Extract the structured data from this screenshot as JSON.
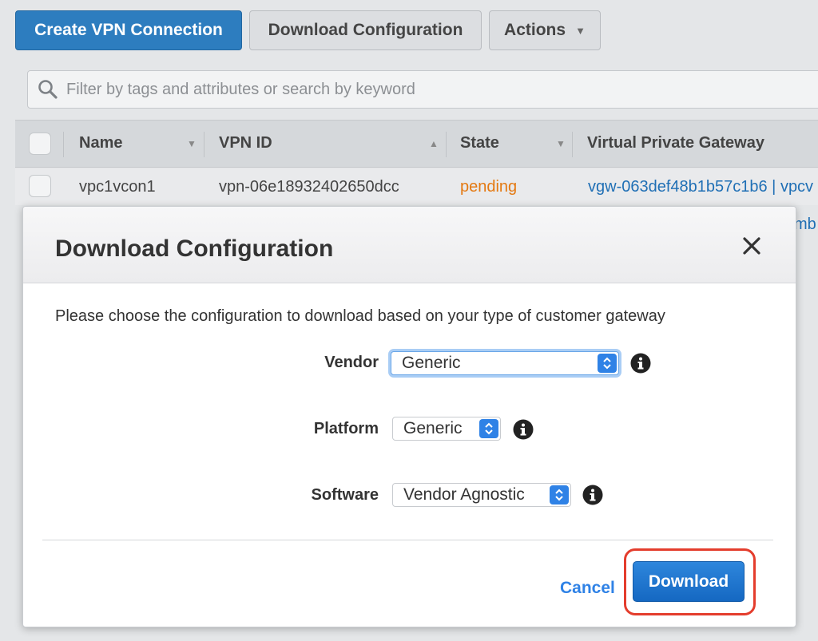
{
  "toolbar": {
    "create_label": "Create VPN Connection",
    "download_config_label": "Download Configuration",
    "actions_label": "Actions"
  },
  "search": {
    "placeholder": "Filter by tags and attributes or search by keyword"
  },
  "table": {
    "columns": [
      "Name",
      "VPN ID",
      "State",
      "Virtual Private Gateway"
    ],
    "rows": [
      {
        "name": "vpc1vcon1",
        "vpn_id": "vpn-06e18932402650dcc",
        "state": "pending",
        "gateway": "vgw-063def48b1b57c1b6 | vpcv"
      }
    ],
    "row2_partial": "mb"
  },
  "modal": {
    "title": "Download Configuration",
    "instruction": "Please choose the configuration to download based on your type of customer gateway",
    "vendor_label": "Vendor",
    "vendor_value": "Generic",
    "platform_label": "Platform",
    "platform_value": "Generic",
    "software_label": "Software",
    "software_value": "Vendor Agnostic",
    "cancel_label": "Cancel",
    "download_label": "Download"
  },
  "colors": {
    "primary": "#2d7dbf",
    "state_pending": "#e47911",
    "link": "#1f6fb5",
    "highlight": "#e43d2d"
  },
  "icons": [
    "search-icon",
    "chevron-down-icon",
    "sort-icon",
    "close-icon",
    "info-icon",
    "stepper-icon"
  ]
}
